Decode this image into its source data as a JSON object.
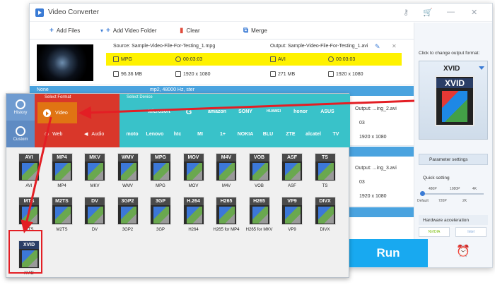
{
  "app": {
    "title": "Video Converter"
  },
  "toolbar": {
    "add_files": "Add Files",
    "add_folder": "Add Video Folder",
    "clear": "Clear",
    "merge": "Merge"
  },
  "file1": {
    "source": "Source: Sample-Video-File-For-Testing_1.mpg",
    "output": "Output: Sample-Video-File-For-Testing_1.avi",
    "src_format": "MPG",
    "src_duration": "00:03:03",
    "src_size": "96.36 MB",
    "src_res": "1920 x 1080",
    "out_format": "AVI",
    "out_duration": "00:03:03",
    "out_size": "271 MB",
    "out_res": "1920 x 1080"
  },
  "audio_row": {
    "subtitle": "None",
    "audio": "mp2, 48000 Hz, ster"
  },
  "file2": {
    "output": "Output: ...ing_2.avi",
    "dur": "03",
    "res": "1920 x 1080"
  },
  "file3": {
    "output": "Output: ...ing_3.avi",
    "dur": "03",
    "res": "1920 x 1080"
  },
  "right_panel": {
    "caption": "Click to change output format:",
    "format": "XVID",
    "param_settings": "Parameter settings",
    "quick_setting": "Quick setting",
    "levels_top": [
      "480P",
      "1080P",
      "4K"
    ],
    "levels_bottom": [
      "Default",
      "720P",
      "2K"
    ],
    "hw_accel": "Hardware acceleration",
    "hw_brands": [
      "NVIDIA",
      "Intel"
    ]
  },
  "run": "Run",
  "format_panel": {
    "select_format": "Select Format",
    "select_device": "Select Device",
    "side": [
      {
        "label": "History"
      },
      {
        "label": "Custom"
      }
    ],
    "tabs": {
      "video": "Video",
      "web": "Web",
      "audio": "Audio"
    },
    "brands_row1": [
      "",
      "Microsoft",
      "G",
      "amazon",
      "SONY",
      "HUAWEI",
      "honor",
      "ASUS"
    ],
    "brands_row2": [
      "moto",
      "Lenovo",
      "htc",
      "MI",
      "1+",
      "NOKIA",
      "BLU",
      "ZTE",
      "alcatel",
      "TV"
    ],
    "formats": [
      {
        "tag": "AVI",
        "name": "AVI",
        "color": "#4a4a4a"
      },
      {
        "tag": "MP4",
        "name": "MP4",
        "color": "#4a4a4a"
      },
      {
        "tag": "MKV",
        "name": "MKV",
        "color": "#4a4a4a"
      },
      {
        "tag": "WMV",
        "name": "WMV",
        "color": "#4a4a4a"
      },
      {
        "tag": "MPG",
        "name": "MPG",
        "color": "#4a4a4a"
      },
      {
        "tag": "MOV",
        "name": "MOV",
        "color": "#4a4a4a"
      },
      {
        "tag": "M4V",
        "name": "M4V",
        "color": "#4a4a4a"
      },
      {
        "tag": "VOB",
        "name": "VOB",
        "color": "#4a4a4a"
      },
      {
        "tag": "ASF",
        "name": "ASF",
        "color": "#4a4a4a"
      },
      {
        "tag": "TS",
        "name": "TS",
        "color": "#4a4a4a"
      },
      {
        "tag": "MTS",
        "name": "MTS",
        "color": "#4a4a4a"
      },
      {
        "tag": "M2TS",
        "name": "M2TS",
        "color": "#4a4a4a"
      },
      {
        "tag": "DV",
        "name": "DV",
        "color": "#4a4a4a"
      },
      {
        "tag": "3GP2",
        "name": "3GP2",
        "color": "#4a4a4a"
      },
      {
        "tag": "3GP",
        "name": "3GP",
        "color": "#4a4a4a"
      },
      {
        "tag": "H.264",
        "name": "H264",
        "color": "#4a4a4a"
      },
      {
        "tag": "H265",
        "name": "H265 for MP4",
        "color": "#4a4a4a"
      },
      {
        "tag": "H265",
        "name": "H265 for MKV",
        "color": "#4a4a4a"
      },
      {
        "tag": "VP9",
        "name": "VP9",
        "color": "#4a4a4a"
      },
      {
        "tag": "DIVX",
        "name": "DIVX",
        "color": "#4a4a4a"
      },
      {
        "tag": "XVID",
        "name": "XVID",
        "color": "#2a3e66"
      }
    ]
  },
  "colors": {
    "accent": "#18a9f0",
    "highlight": "#fff200",
    "annotation": "#e31e24",
    "format_tab": "#d9372a",
    "device": "#39c2c9"
  }
}
